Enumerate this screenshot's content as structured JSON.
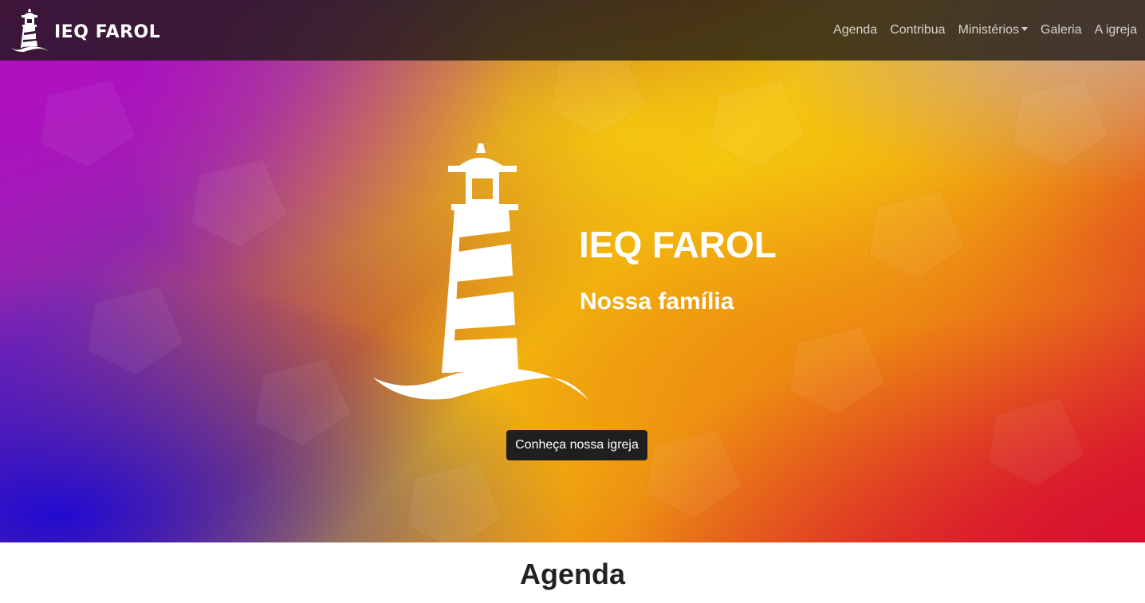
{
  "navbar": {
    "brand": "IEQ FAROL",
    "links": [
      {
        "label": "Agenda"
      },
      {
        "label": "Contribua"
      },
      {
        "label": "Ministérios",
        "dropdown": true
      },
      {
        "label": "Galeria"
      },
      {
        "label": "A igreja"
      }
    ],
    "background": "#1c1814"
  },
  "hero": {
    "title": "IEQ FAROL",
    "subtitle": "Nossa família",
    "cta_label": "Conheça nossa igreja",
    "gradient_colors": [
      "#b20ec4",
      "#8a2da8",
      "#f2bd0c",
      "#e76a1a",
      "#d9182f"
    ]
  },
  "agenda": {
    "heading": "Agenda"
  },
  "icons": {
    "brand_logo": "lighthouse-icon",
    "hero_image": "lighthouse-icon",
    "dropdown": "caret-down-icon"
  }
}
